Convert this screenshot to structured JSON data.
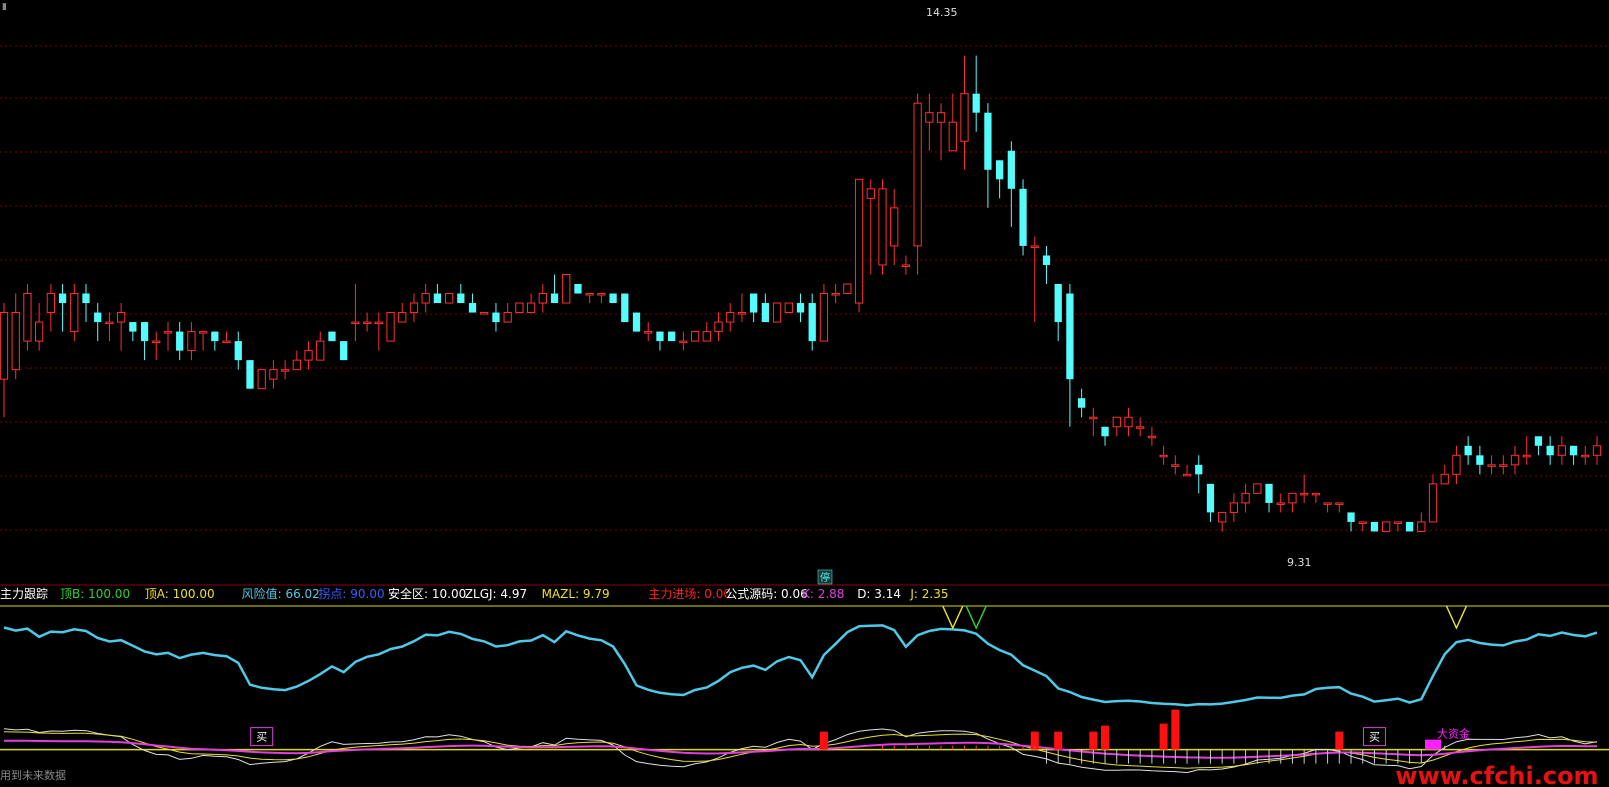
{
  "header_glyph": "▮",
  "indicator_legend": {
    "title": "主力跟踪",
    "items": [
      {
        "label": "顶B:",
        "value": "100.00",
        "color": "#30d030"
      },
      {
        "label": "顶A:",
        "value": "100.00",
        "color": "#f0e020"
      },
      {
        "label": "风险值:",
        "value": "66.02",
        "color": "#4ec9e8"
      },
      {
        "label": "拐点:",
        "value": "90.00",
        "color": "#3a5cff"
      },
      {
        "label": "安全区:",
        "value": "10.00",
        "color": "#ffffff"
      },
      {
        "label": "ZLGJ:",
        "value": "4.97",
        "color": "#ffffff"
      },
      {
        "label": "MAZL:",
        "value": "9.79",
        "color": "#f0e020"
      },
      {
        "label": "主力进场:",
        "value": "0.00",
        "color": "#ff2020"
      },
      {
        "label": "公式源码:",
        "value": "0.06",
        "color": "#ffffff"
      },
      {
        "label": "K:",
        "value": "2.88",
        "color": "#e040e0"
      },
      {
        "label": "D:",
        "value": "3.14",
        "color": "#ffffff"
      },
      {
        "label": "J:",
        "value": "2.35",
        "color": "#f0e020"
      }
    ]
  },
  "annotations": {
    "high": "14.35",
    "low": "9.31",
    "suspended": "停",
    "buy_1": "买",
    "buy_2": "买",
    "funds": "大资金",
    "footer": "用到未来数据",
    "watermark": "www.cfchi.com"
  },
  "colors": {
    "up": "#ff3030",
    "down": "#54fcfc",
    "grid": "#7a0000",
    "risk": "#4ec9e8",
    "k": "#e040e0",
    "d": "#e0e0e0",
    "j": "#e8e030",
    "signal": "#ff1010",
    "top_a": "#e8e030",
    "top_b": "#30d030",
    "watermark": "#e81010"
  },
  "chart_data": {
    "type": "candlestick",
    "y_range_main": [
      9.0,
      14.8
    ],
    "candles": [
      [
        10.9,
        11.6,
        10.5,
        11.7
      ],
      [
        11.0,
        11.6,
        10.9,
        11.8
      ],
      [
        11.3,
        11.8,
        11.2,
        11.9
      ],
      [
        11.3,
        11.5,
        11.2,
        11.7
      ],
      [
        11.6,
        11.8,
        11.4,
        11.9
      ],
      [
        11.8,
        11.7,
        11.4,
        11.9
      ],
      [
        11.4,
        11.8,
        11.3,
        11.9
      ],
      [
        11.8,
        11.7,
        11.5,
        11.9
      ],
      [
        11.6,
        11.5,
        11.3,
        11.7
      ],
      [
        11.5,
        11.5,
        11.3,
        11.6
      ],
      [
        11.5,
        11.6,
        11.2,
        11.7
      ],
      [
        11.5,
        11.4,
        11.3,
        11.5
      ],
      [
        11.5,
        11.3,
        11.1,
        11.5
      ],
      [
        11.3,
        11.3,
        11.1,
        11.4
      ],
      [
        11.4,
        11.4,
        11.2,
        11.5
      ],
      [
        11.4,
        11.2,
        11.1,
        11.5
      ],
      [
        11.2,
        11.4,
        11.1,
        11.5
      ],
      [
        11.4,
        11.4,
        11.2,
        11.4
      ],
      [
        11.4,
        11.3,
        11.2,
        11.4
      ],
      [
        11.3,
        11.3,
        11.3,
        11.4
      ],
      [
        11.3,
        11.1,
        11.0,
        11.4
      ],
      [
        11.1,
        10.8,
        10.8,
        11.1
      ],
      [
        10.8,
        11.0,
        10.8,
        11.0
      ],
      [
        10.9,
        11.0,
        10.8,
        11.1
      ],
      [
        11.0,
        11.0,
        10.9,
        11.1
      ],
      [
        11.0,
        11.1,
        11.0,
        11.2
      ],
      [
        11.1,
        11.2,
        11.0,
        11.3
      ],
      [
        11.1,
        11.3,
        11.1,
        11.4
      ],
      [
        11.4,
        11.3,
        11.3,
        11.4
      ],
      [
        11.3,
        11.1,
        11.1,
        11.3
      ],
      [
        11.5,
        11.5,
        11.3,
        11.9
      ],
      [
        11.5,
        11.5,
        11.4,
        11.6
      ],
      [
        11.5,
        11.5,
        11.2,
        11.6
      ],
      [
        11.3,
        11.6,
        11.3,
        11.6
      ],
      [
        11.5,
        11.6,
        11.5,
        11.7
      ],
      [
        11.6,
        11.7,
        11.5,
        11.8
      ],
      [
        11.7,
        11.8,
        11.6,
        11.9
      ],
      [
        11.8,
        11.7,
        11.7,
        11.9
      ],
      [
        11.7,
        11.8,
        11.7,
        11.8
      ],
      [
        11.8,
        11.7,
        11.7,
        11.9
      ],
      [
        11.7,
        11.6,
        11.6,
        11.8
      ],
      [
        11.6,
        11.6,
        11.6,
        11.6
      ],
      [
        11.6,
        11.5,
        11.4,
        11.7
      ],
      [
        11.5,
        11.6,
        11.5,
        11.7
      ],
      [
        11.6,
        11.7,
        11.6,
        11.7
      ],
      [
        11.6,
        11.7,
        11.6,
        11.8
      ],
      [
        11.7,
        11.8,
        11.6,
        11.9
      ],
      [
        11.8,
        11.7,
        11.7,
        12.0
      ],
      [
        11.7,
        12.0,
        11.7,
        12.0
      ],
      [
        11.9,
        11.8,
        11.8,
        11.9
      ],
      [
        11.8,
        11.8,
        11.7,
        11.8
      ],
      [
        11.8,
        11.8,
        11.7,
        11.8
      ],
      [
        11.8,
        11.7,
        11.7,
        11.8
      ],
      [
        11.8,
        11.5,
        11.5,
        11.8
      ],
      [
        11.6,
        11.4,
        11.4,
        11.6
      ],
      [
        11.4,
        11.4,
        11.3,
        11.5
      ],
      [
        11.4,
        11.3,
        11.2,
        11.4
      ],
      [
        11.4,
        11.3,
        11.3,
        11.4
      ],
      [
        11.3,
        11.3,
        11.2,
        11.4
      ],
      [
        11.3,
        11.4,
        11.3,
        11.4
      ],
      [
        11.3,
        11.4,
        11.3,
        11.5
      ],
      [
        11.4,
        11.5,
        11.3,
        11.6
      ],
      [
        11.5,
        11.6,
        11.4,
        11.7
      ],
      [
        11.6,
        11.6,
        11.5,
        11.8
      ],
      [
        11.8,
        11.6,
        11.5,
        11.8
      ],
      [
        11.7,
        11.5,
        11.5,
        11.8
      ],
      [
        11.5,
        11.7,
        11.5,
        11.7
      ],
      [
        11.6,
        11.7,
        11.6,
        11.7
      ],
      [
        11.7,
        11.6,
        11.5,
        11.8
      ],
      [
        11.7,
        11.3,
        11.2,
        11.8
      ],
      [
        11.3,
        11.8,
        11.3,
        11.9
      ],
      [
        11.8,
        11.8,
        11.7,
        11.9
      ],
      [
        11.8,
        11.9,
        11.8,
        11.9
      ],
      [
        11.7,
        13.0,
        11.6,
        13.0
      ],
      [
        12.8,
        12.9,
        12.0,
        13.0
      ],
      [
        12.1,
        12.9,
        12.0,
        13.0
      ],
      [
        12.3,
        12.7,
        12.1,
        12.9
      ],
      [
        12.1,
        12.1,
        12.0,
        12.2
      ],
      [
        12.3,
        13.8,
        12.0,
        13.9
      ],
      [
        13.6,
        13.7,
        13.3,
        13.9
      ],
      [
        13.6,
        13.7,
        13.2,
        13.8
      ],
      [
        13.3,
        13.6,
        13.3,
        13.9
      ],
      [
        13.4,
        13.9,
        13.1,
        14.3
      ],
      [
        13.9,
        13.7,
        13.5,
        14.3
      ],
      [
        13.7,
        13.1,
        12.7,
        13.8
      ],
      [
        13.2,
        13.0,
        12.8,
        13.2
      ],
      [
        13.3,
        12.9,
        12.5,
        13.4
      ],
      [
        12.9,
        12.3,
        12.2,
        13.0
      ],
      [
        12.3,
        12.3,
        11.5,
        12.4
      ],
      [
        12.2,
        12.1,
        11.9,
        12.3
      ],
      [
        11.9,
        11.5,
        11.3,
        11.9
      ],
      [
        11.8,
        10.9,
        10.4,
        11.9
      ],
      [
        10.7,
        10.6,
        10.5,
        10.8
      ],
      [
        10.5,
        10.5,
        10.3,
        10.6
      ],
      [
        10.4,
        10.3,
        10.2,
        10.4
      ],
      [
        10.4,
        10.5,
        10.3,
        10.5
      ],
      [
        10.4,
        10.5,
        10.3,
        10.6
      ],
      [
        10.4,
        10.4,
        10.3,
        10.5
      ],
      [
        10.3,
        10.3,
        10.2,
        10.4
      ],
      [
        10.1,
        10.1,
        10.0,
        10.2
      ],
      [
        10.0,
        10.0,
        9.9,
        10.1
      ],
      [
        9.9,
        9.9,
        9.9,
        10.0
      ],
      [
        10.0,
        9.9,
        9.7,
        10.1
      ],
      [
        9.8,
        9.5,
        9.4,
        9.8
      ],
      [
        9.4,
        9.5,
        9.3,
        9.5
      ],
      [
        9.5,
        9.6,
        9.4,
        9.7
      ],
      [
        9.6,
        9.7,
        9.5,
        9.8
      ],
      [
        9.7,
        9.8,
        9.7,
        9.8
      ],
      [
        9.8,
        9.6,
        9.5,
        9.8
      ],
      [
        9.6,
        9.6,
        9.5,
        9.7
      ],
      [
        9.6,
        9.7,
        9.5,
        9.7
      ],
      [
        9.7,
        9.7,
        9.6,
        9.9
      ],
      [
        9.7,
        9.7,
        9.6,
        9.7
      ],
      [
        9.6,
        9.6,
        9.5,
        9.6
      ],
      [
        9.6,
        9.6,
        9.5,
        9.6
      ],
      [
        9.5,
        9.4,
        9.3,
        9.5
      ],
      [
        9.4,
        9.4,
        9.3,
        9.4
      ],
      [
        9.4,
        9.3,
        9.3,
        9.4
      ],
      [
        9.3,
        9.4,
        9.3,
        9.4
      ],
      [
        9.4,
        9.4,
        9.3,
        9.4
      ],
      [
        9.4,
        9.3,
        9.3,
        9.4
      ],
      [
        9.3,
        9.4,
        9.3,
        9.5
      ],
      [
        9.4,
        9.8,
        9.4,
        9.9
      ],
      [
        9.8,
        9.9,
        9.8,
        10.0
      ],
      [
        9.9,
        10.1,
        9.8,
        10.2
      ],
      [
        10.2,
        10.1,
        10.0,
        10.3
      ],
      [
        10.1,
        10.0,
        9.9,
        10.2
      ],
      [
        10.0,
        10.0,
        9.9,
        10.1
      ],
      [
        10.0,
        10.0,
        9.9,
        10.1
      ],
      [
        10.0,
        10.1,
        9.9,
        10.2
      ],
      [
        10.1,
        10.1,
        10.0,
        10.3
      ],
      [
        10.3,
        10.2,
        10.1,
        10.3
      ],
      [
        10.2,
        10.1,
        10.0,
        10.3
      ],
      [
        10.1,
        10.2,
        10.0,
        10.3
      ],
      [
        10.2,
        10.1,
        10.0,
        10.2
      ],
      [
        10.1,
        10.1,
        10.0,
        10.2
      ],
      [
        10.1,
        10.2,
        10.0,
        10.3
      ]
    ],
    "indicator_range": [
      -10,
      100
    ]
  }
}
